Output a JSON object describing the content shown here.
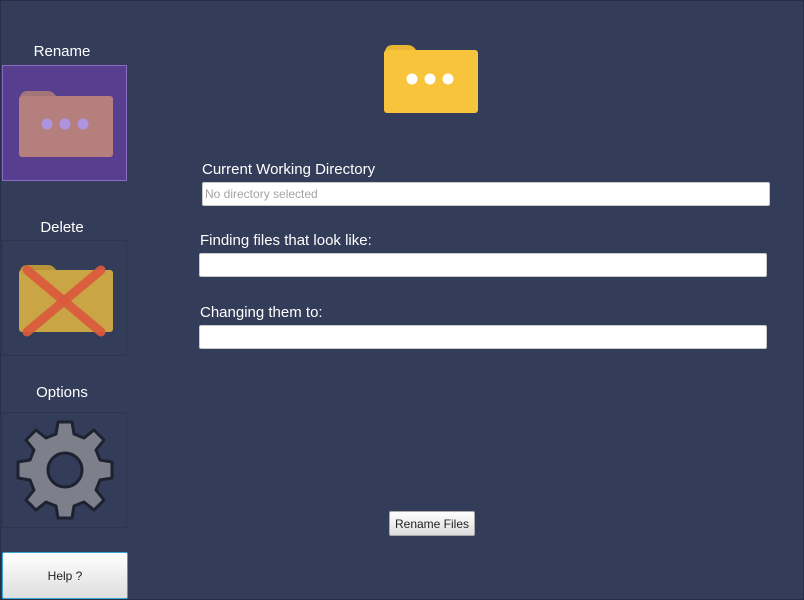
{
  "sidebar": {
    "items": [
      {
        "label": "Rename",
        "icon": "folder-dots-icon",
        "selected": true
      },
      {
        "label": "Delete",
        "icon": "folder-x-icon",
        "selected": false
      },
      {
        "label": "Options",
        "icon": "gear-icon",
        "selected": false
      }
    ],
    "help_label": "Help ?"
  },
  "main": {
    "icon": "folder-dots-icon",
    "cwd": {
      "label": "Current Working Directory",
      "value": "",
      "placeholder": "No directory selected"
    },
    "find": {
      "label": "Finding files that look like:",
      "value": ""
    },
    "change": {
      "label": "Changing them to:",
      "value": ""
    },
    "rename_button": "Rename Files"
  },
  "colors": {
    "background": "#333c58",
    "selected_tile": "#573e8f",
    "folder_yellow": "#f7c43c",
    "delete_x": "#e0533c",
    "gear": "#7c7f89"
  }
}
